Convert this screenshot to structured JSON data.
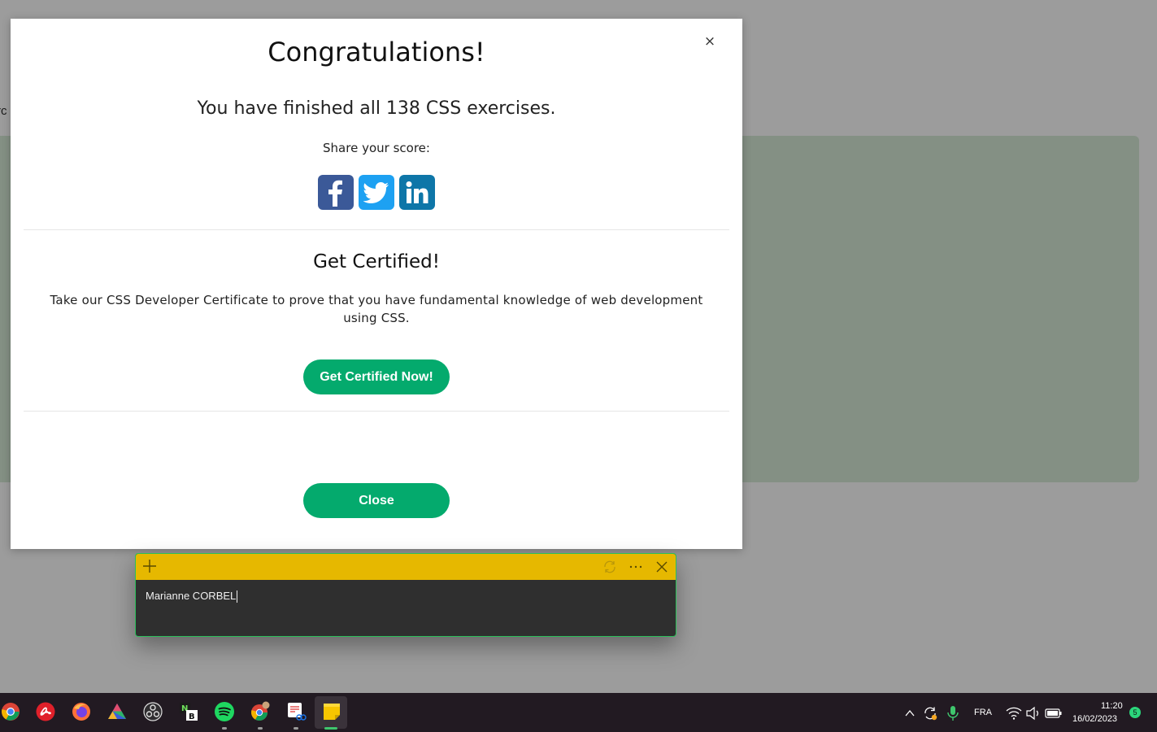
{
  "background": {
    "edge_text": "rc",
    "panel_color": "#849084"
  },
  "modal": {
    "close_glyph": "×",
    "title": "Congratulations!",
    "finished_text": "You have finished all 138 CSS exercises.",
    "share_label": "Share your score:",
    "share_buttons": [
      {
        "icon": "facebook-icon",
        "color": "#3b5998"
      },
      {
        "icon": "twitter-icon",
        "color": "#1da1f2"
      },
      {
        "icon": "linkedin-icon",
        "color": "#0e76a8"
      }
    ],
    "cert_title": "Get Certified!",
    "cert_desc": "Take our CSS Developer Certificate to prove that you have fundamental knowledge of web development using CSS.",
    "cert_button": "Get Certified Now!",
    "close_button": "Close",
    "accent_color": "#04aa6d"
  },
  "sticky_note": {
    "bar_color": "#e6b800",
    "text": "Marianne CORBEL",
    "actions": [
      "sync-icon",
      "more-icon",
      "close-icon"
    ]
  },
  "taskbar": {
    "apps": [
      "chrome-icon",
      "adobe-acrobat-icon",
      "firefox-icon",
      "affinity-icon",
      "obs-icon",
      "notebook-icon",
      "spotify-icon",
      "chrome-profile-icon",
      "snipping-tool-icon",
      "sticky-notes-icon"
    ],
    "tray": {
      "language": "FRA",
      "time": "11:20",
      "date": "16/02/2023",
      "notification_count": "5"
    }
  }
}
